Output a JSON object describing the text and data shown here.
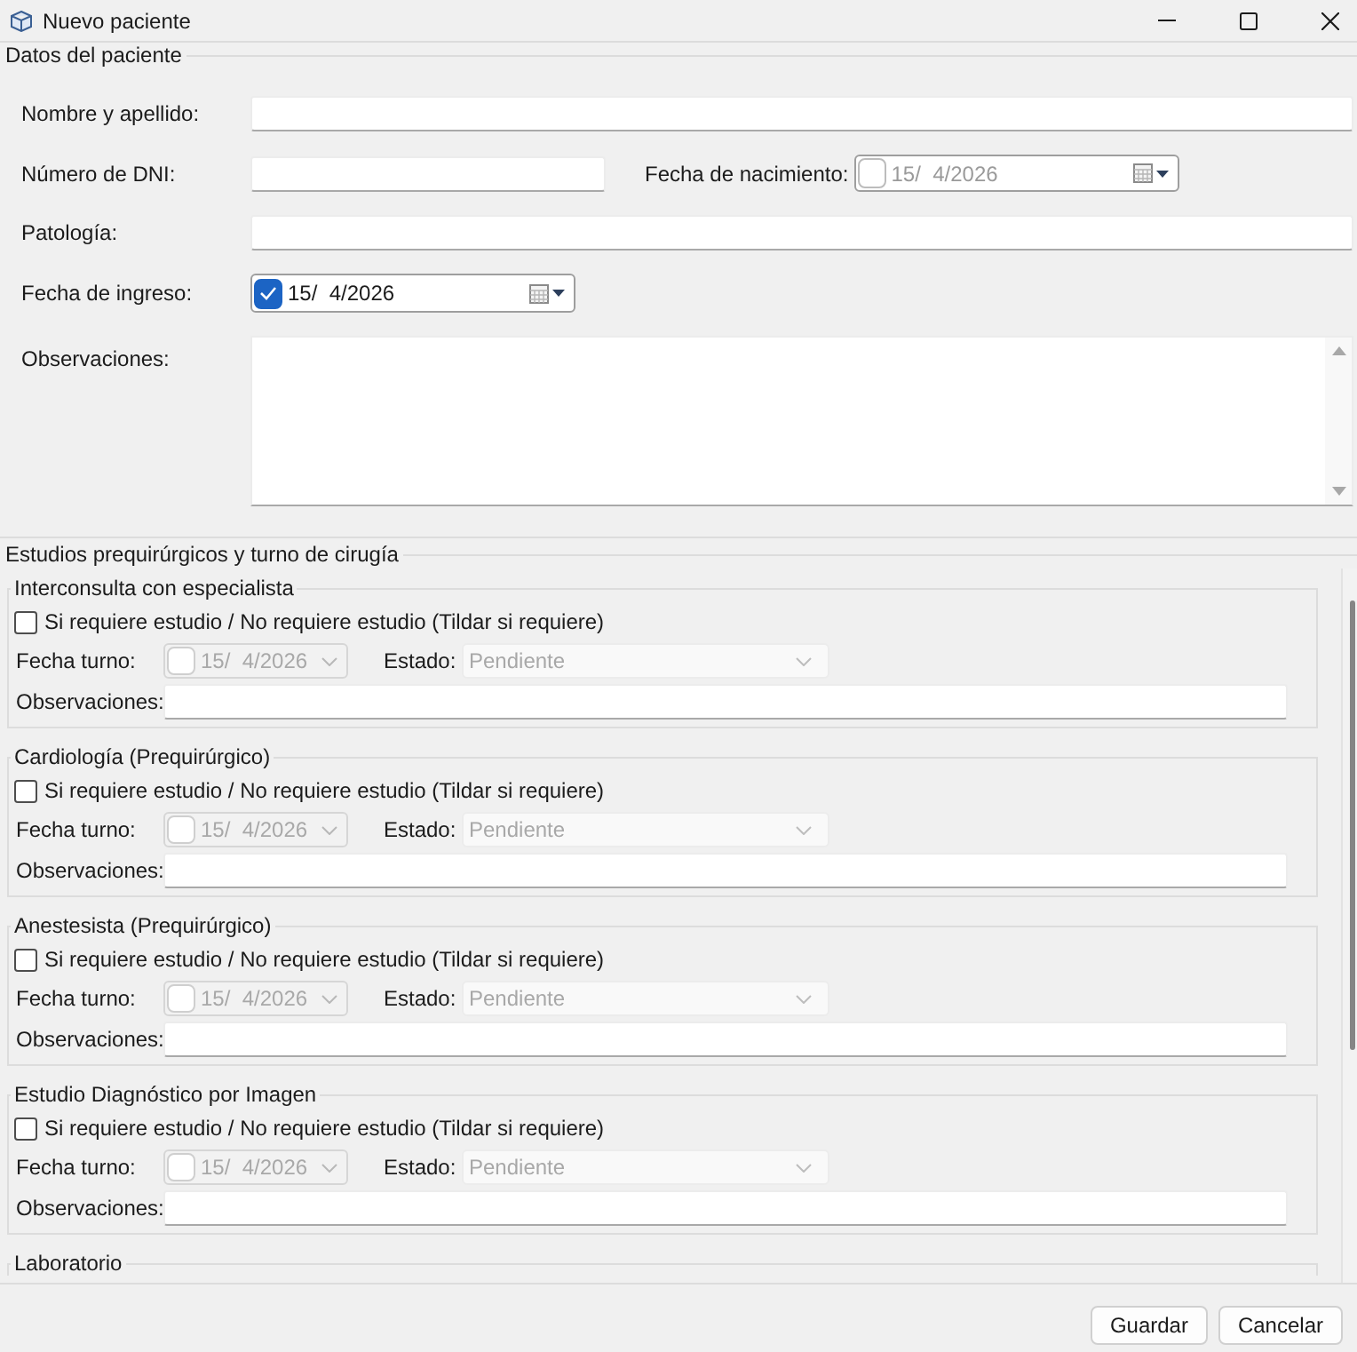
{
  "window": {
    "title": "Nuevo paciente"
  },
  "patient": {
    "title": "Datos del paciente",
    "full_name": {
      "label": "Nombre y apellido:"
    },
    "dni": {
      "label": "Número de DNI:"
    },
    "birth_date": {
      "label": "Fecha de nacimiento:",
      "checked": false,
      "disabled": false,
      "value": "15/  4/2026"
    },
    "pathology": {
      "label": "Patología:"
    },
    "admission_date": {
      "label": "Fecha de ingreso:",
      "checked": true,
      "disabled": false,
      "value": "15/  4/2026"
    },
    "notes": {
      "label": "Observaciones:"
    }
  },
  "studies": {
    "title": "Estudios prequirúrgicos y turno de cirugía",
    "groups": [
      {
        "title": "Interconsulta con especialista",
        "required": {
          "label": "Si requiere estudio / No requiere estudio (Tildar si requiere)",
          "checked": false
        },
        "appointment": {
          "label": "Fecha turno:",
          "checked": false,
          "disabled": true,
          "value": "15/  4/2026"
        },
        "status": {
          "label": "Estado:",
          "value": "Pendiente",
          "disabled": true
        },
        "notes": {
          "label": "Observaciones:"
        }
      },
      {
        "title": "Cardiología (Prequirúrgico)",
        "required": {
          "label": "Si requiere estudio / No requiere estudio (Tildar si requiere)",
          "checked": false
        },
        "appointment": {
          "label": "Fecha turno:",
          "checked": false,
          "disabled": true,
          "value": "15/  4/2026"
        },
        "status": {
          "label": "Estado:",
          "value": "Pendiente",
          "disabled": true
        },
        "notes": {
          "label": "Observaciones:"
        }
      },
      {
        "title": "Anestesista (Prequirúrgico)",
        "required": {
          "label": "Si requiere estudio / No requiere estudio (Tildar si requiere)",
          "checked": false
        },
        "appointment": {
          "label": "Fecha turno:",
          "checked": false,
          "disabled": true,
          "value": "15/  4/2026"
        },
        "status": {
          "label": "Estado:",
          "value": "Pendiente",
          "disabled": true
        },
        "notes": {
          "label": "Observaciones:"
        }
      },
      {
        "title": "Estudio Diagnóstico por Imagen",
        "required": {
          "label": "Si requiere estudio / No requiere estudio (Tildar si requiere)",
          "checked": false
        },
        "appointment": {
          "label": "Fecha turno:",
          "checked": false,
          "disabled": true,
          "value": "15/  4/2026"
        },
        "status": {
          "label": "Estado:",
          "value": "Pendiente",
          "disabled": true
        },
        "notes": {
          "label": "Observaciones:"
        }
      },
      {
        "title": "Laboratorio"
      }
    ]
  },
  "buttons": [
    {
      "label": "Guardar"
    },
    {
      "label": "Cancelar"
    }
  ]
}
